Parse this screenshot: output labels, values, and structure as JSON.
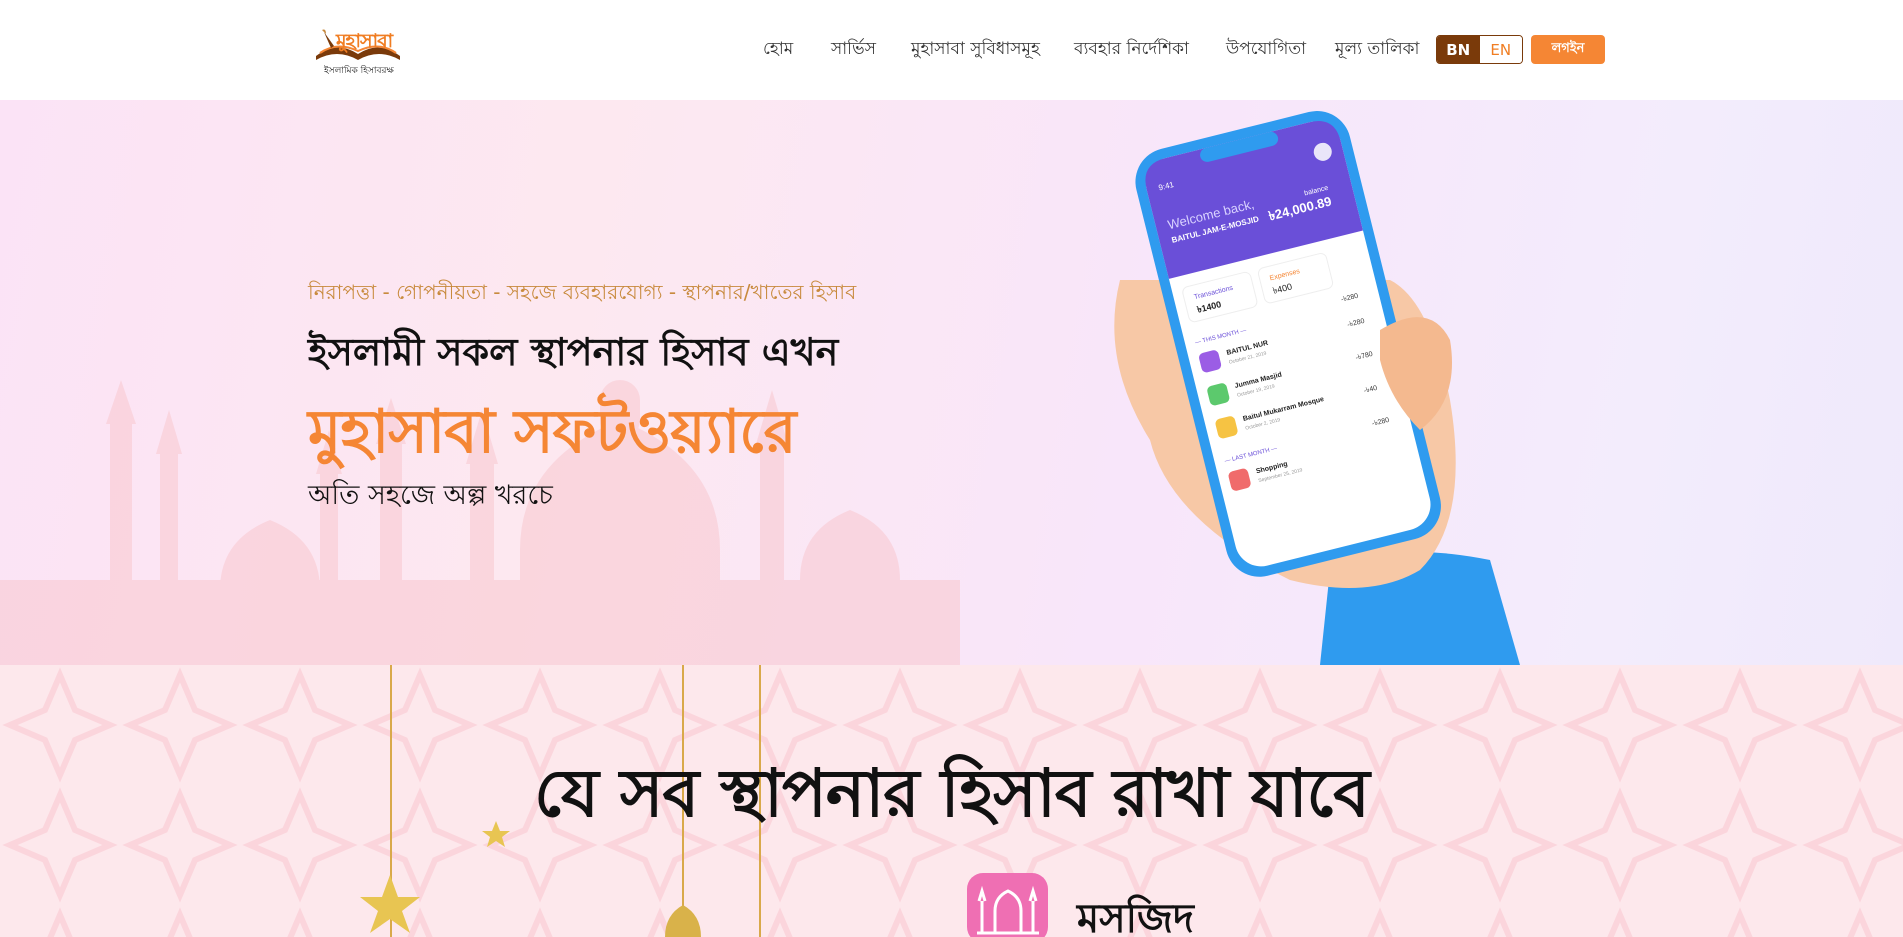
{
  "header": {
    "logo_text": "মুহাসাবা",
    "logo_subtitle": "ইসলামিক হিসাবরক্ষ",
    "nav": [
      {
        "label": "হোম"
      },
      {
        "label": "সার্ভিস"
      },
      {
        "label": "মুহাসাবা সুবিধাসমূহ"
      },
      {
        "label": "ব্যবহার নির্দেশিকা"
      },
      {
        "label": "উপযোগিতা"
      },
      {
        "label": "মূল্য তালিকা"
      }
    ],
    "lang_bn": "BN",
    "lang_en": "EN",
    "login_label": "লগইন"
  },
  "hero": {
    "tagline": "নিরাপত্তা - গোপনীয়তা - সহজে ব্যবহারযোগ্য - স্থাপনার/খাতের হিসাব",
    "heading_line1": "ইসলামী সকল স্থাপনার হিসাব এখন",
    "heading_line2": "মুহাসাবা সফটওয়্যারে",
    "subheading": "অতি সহজে অল্প খরচে"
  },
  "phone": {
    "time": "9:41",
    "welcome": "Welcome back,",
    "account": "BAITUL JAM-E-MOSJID",
    "balance_label": "balance",
    "balance": "৳24,000.89",
    "transactions_label": "Transactions",
    "transactions_value": "৳1400",
    "expenses_label": "Expenses",
    "expenses_value": "৳400",
    "this_month": "— THIS MONTH —",
    "last_month": "— LAST MONTH —",
    "items": [
      {
        "name": "BAITUL NUR",
        "date": "October 21, 2019",
        "amount": "-৳280"
      },
      {
        "name": "Jumma Masjid",
        "date": "October 19, 2019",
        "amount": "-৳780"
      },
      {
        "name": "Baitul Mukarram Mosque",
        "date": "October 2, 2019",
        "amount": "-৳40"
      },
      {
        "name": "Shopping",
        "date": "September 25, 2019",
        "amount": "-৳280"
      }
    ],
    "top_amount": "-৳280"
  },
  "section2": {
    "title": "যে সব স্থাপনার হিসাব রাখা যাবে",
    "category_label": "মসজিদ"
  },
  "colors": {
    "brand_orange": "#f58634",
    "brand_brown": "#7a3a0a",
    "tagline_gold": "#c88a3d",
    "app_purple": "#6a4fd8",
    "phone_blue": "#2f9bef",
    "category_pink": "#ef6fb3"
  }
}
